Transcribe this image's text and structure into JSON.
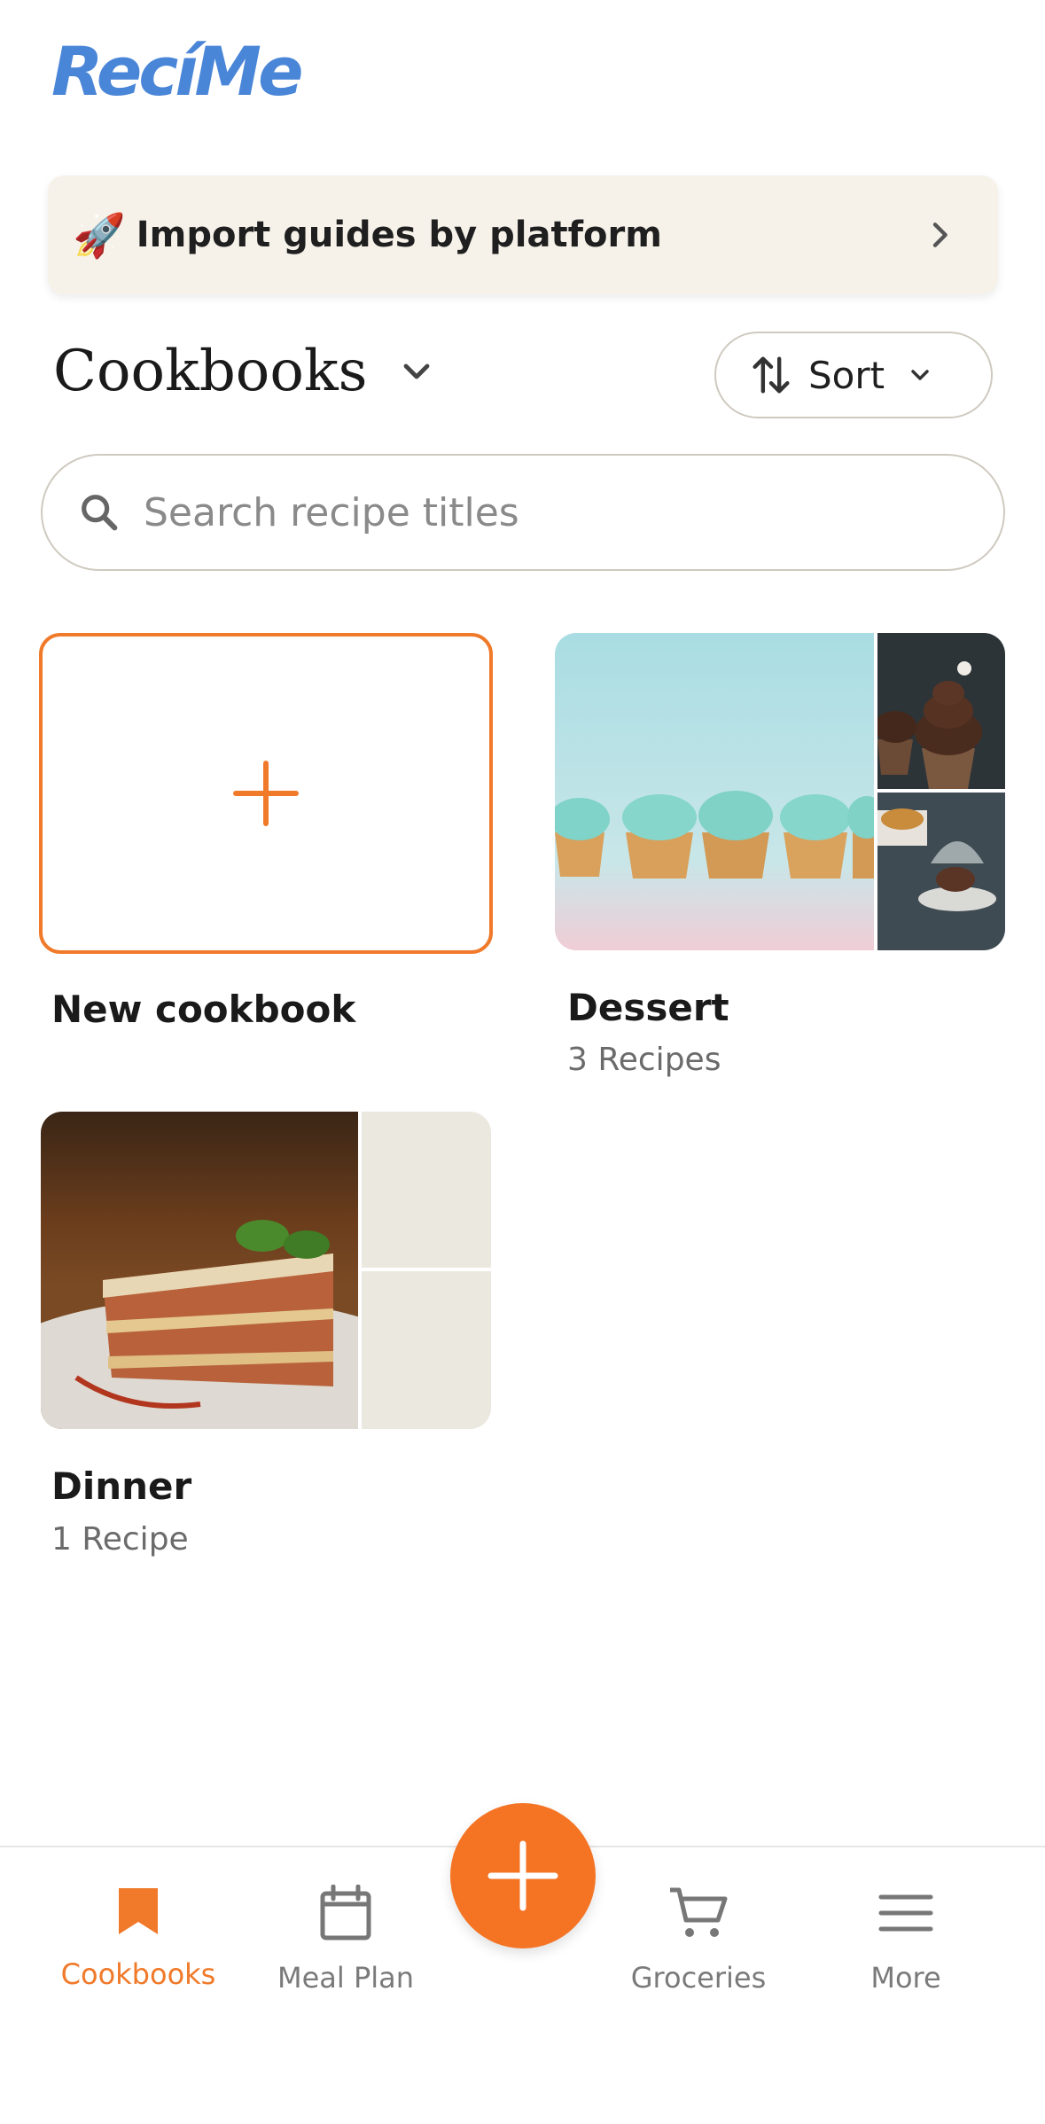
{
  "app": {
    "logo_text": "RecíMe",
    "brand_color": "#4a86d8",
    "accent_color": "#f07a2a"
  },
  "banner": {
    "icon": "rocket-icon",
    "label": "Import guides by platform"
  },
  "section": {
    "title": "Cookbooks"
  },
  "sort": {
    "label": "Sort"
  },
  "search": {
    "placeholder": "Search recipe titles",
    "value": ""
  },
  "cookbooks": {
    "new": {
      "label": "New cookbook"
    },
    "items": [
      {
        "title": "Dessert",
        "count": "3 Recipes"
      },
      {
        "title": "Dinner",
        "count": "1 Recipe"
      }
    ]
  },
  "nav": {
    "items": [
      {
        "label": "Cookbooks",
        "icon": "bookmark-icon",
        "active": true
      },
      {
        "label": "Meal Plan",
        "icon": "calendar-icon",
        "active": false
      },
      {
        "label": "Groceries",
        "icon": "cart-icon",
        "active": false
      },
      {
        "label": "More",
        "icon": "menu-icon",
        "active": false
      }
    ],
    "fab_icon": "plus-icon"
  }
}
